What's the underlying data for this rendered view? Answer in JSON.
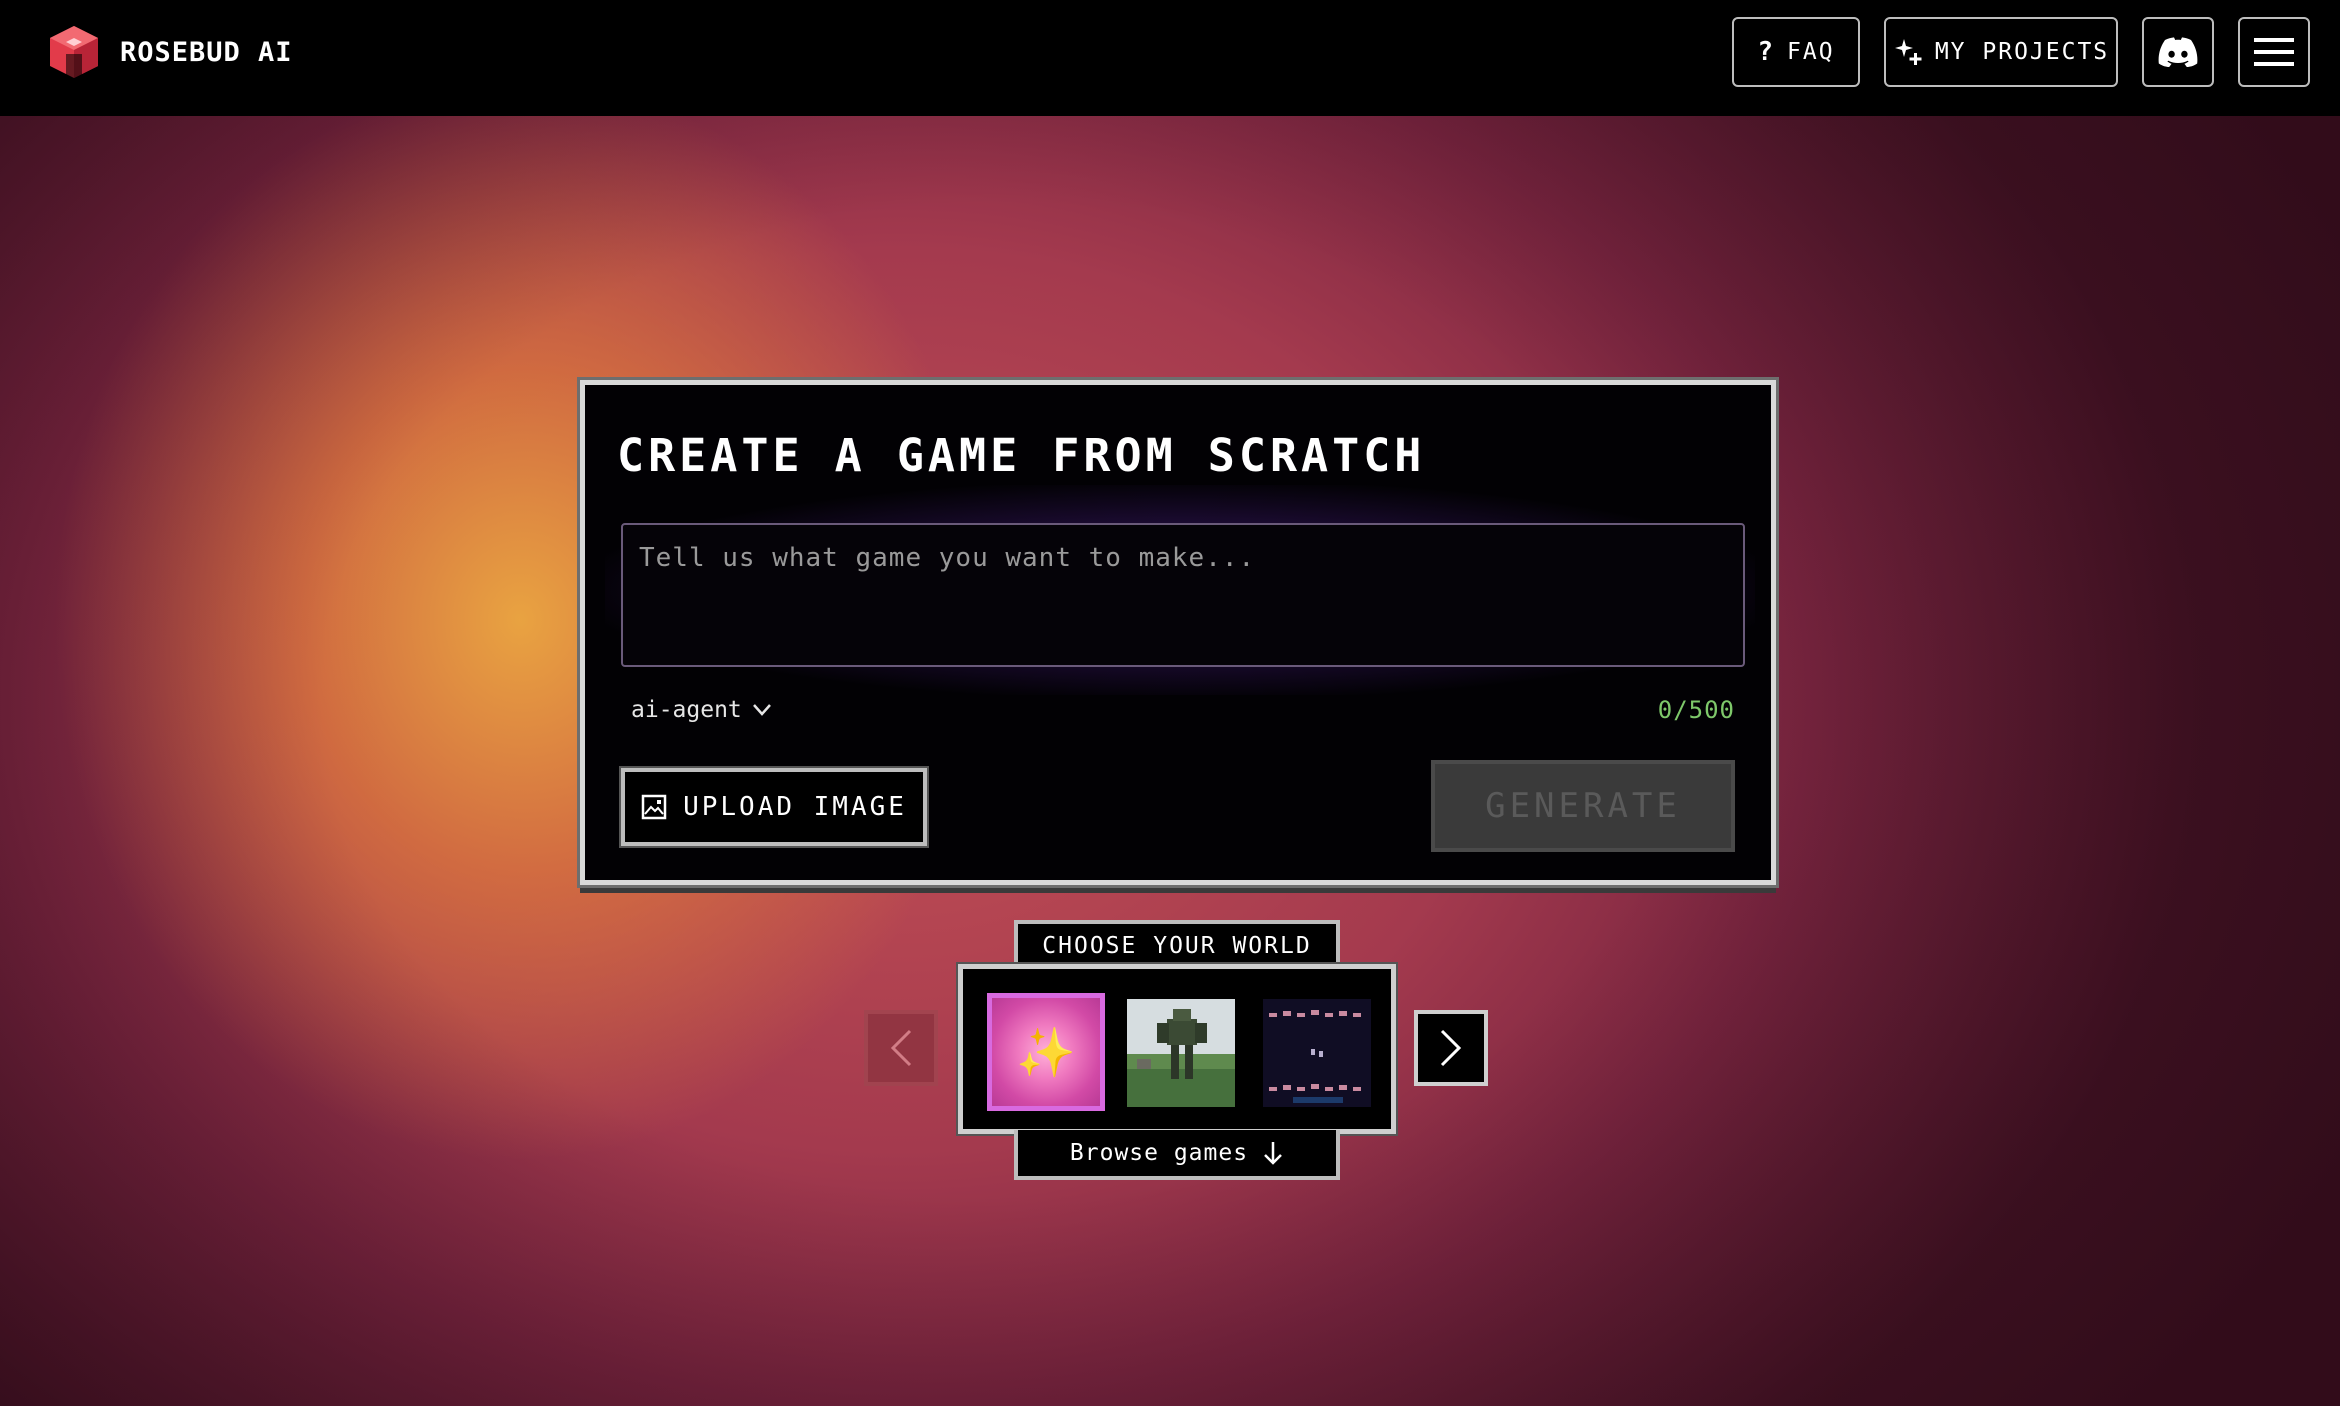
{
  "header": {
    "brand": "ROSEBUD AI",
    "faq_label": "FAQ",
    "projects_label": "MY PROJECTS",
    "discord_icon": "discord-icon",
    "menu_icon": "hamburger-menu-icon"
  },
  "card": {
    "title": "CREATE A GAME FROM SCRATCH",
    "prompt_placeholder": "Tell us what game you want to make...",
    "prompt_value": "",
    "agent_selected": "ai-agent",
    "counter": "0/500",
    "upload_label": "UPLOAD IMAGE",
    "generate_label": "GENERATE"
  },
  "world": {
    "label": "CHOOSE YOUR WORLD",
    "browse_label": "Browse games",
    "thumbs": [
      {
        "name": "magic-sparkles",
        "icon": "sparkles-icon"
      },
      {
        "name": "mech-robot-scene"
      },
      {
        "name": "space-invaders-scene"
      }
    ]
  },
  "colors": {
    "accent_pink": "#d86ae0",
    "counter_green": "#7ec86a",
    "logo_red": "#e8414f"
  }
}
